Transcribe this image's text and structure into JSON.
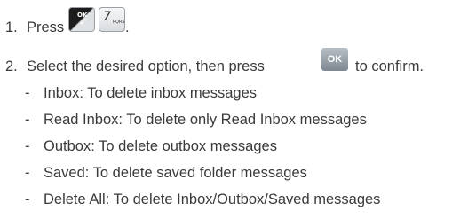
{
  "step1": {
    "number": "1.",
    "text": "Press",
    "end": ".",
    "key_ok_top": "OK",
    "key_ok_bottom": "#",
    "key_seven_digit": "7",
    "key_seven_letters": "PQRS"
  },
  "step2": {
    "number": "2.",
    "text_before": "Select the desired option, then press",
    "key_ok": "OK",
    "text_after": "to confirm."
  },
  "options": [
    {
      "dash": "-",
      "text": "Inbox: To delete inbox messages"
    },
    {
      "dash": "-",
      "text": "Read Inbox: To delete only Read Inbox messages"
    },
    {
      "dash": "-",
      "text": "Outbox: To delete outbox messages"
    },
    {
      "dash": "-",
      "text": "Saved: To delete saved folder messages"
    },
    {
      "dash": "-",
      "text": "Delete All: To delete Inbox/Outbox/Saved messages"
    }
  ]
}
